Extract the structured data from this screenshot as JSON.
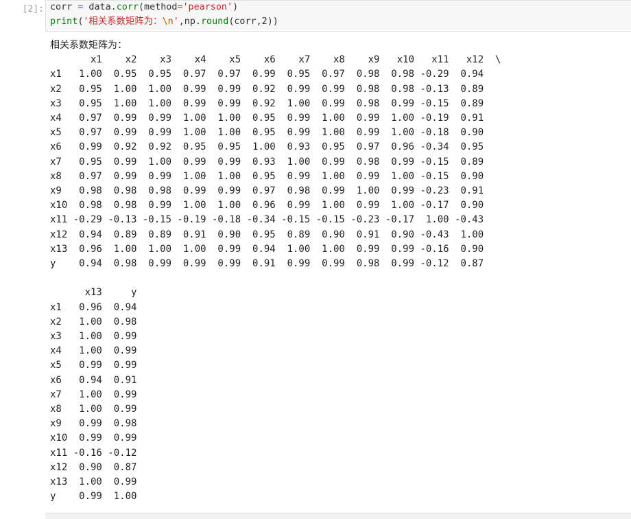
{
  "cell": {
    "prompt": "[2]:",
    "code": {
      "line1": {
        "a": "corr",
        "b": " ",
        "c": "=",
        "d": " data.",
        "e": "corr",
        "f": "(method",
        "g": "=",
        "h": "'pearson'",
        "i": ")"
      },
      "line2": {
        "a": "print",
        "b": "(",
        "c": "'相关系数矩阵为：",
        "d": "\\n",
        "e": "'",
        "f": ",np.",
        "g": "round",
        "h": "(corr,2))"
      }
    }
  },
  "output": {
    "text": "相关系数矩阵为：\n       x1    x2    x3    x4    x5    x6    x7    x8    x9   x10   x11   x12  \\\nx1   1.00  0.95  0.95  0.97  0.97  0.99  0.95  0.97  0.98  0.98 -0.29  0.94\nx2   0.95  1.00  1.00  0.99  0.99  0.92  0.99  0.99  0.98  0.98 -0.13  0.89\nx3   0.95  1.00  1.00  0.99  0.99  0.92  1.00  0.99  0.98  0.99 -0.15  0.89\nx4   0.97  0.99  0.99  1.00  1.00  0.95  0.99  1.00  0.99  1.00 -0.19  0.91\nx5   0.97  0.99  0.99  1.00  1.00  0.95  0.99  1.00  0.99  1.00 -0.18  0.90\nx6   0.99  0.92  0.92  0.95  0.95  1.00  0.93  0.95  0.97  0.96 -0.34  0.95\nx7   0.95  0.99  1.00  0.99  0.99  0.93  1.00  0.99  0.98  0.99 -0.15  0.89\nx8   0.97  0.99  0.99  1.00  1.00  0.95  0.99  1.00  0.99  1.00 -0.15  0.90\nx9   0.98  0.98  0.98  0.99  0.99  0.97  0.98  0.99  1.00  0.99 -0.23  0.91\nx10  0.98  0.98  0.99  1.00  1.00  0.96  0.99  1.00  0.99  1.00 -0.17  0.90\nx11 -0.29 -0.13 -0.15 -0.19 -0.18 -0.34 -0.15 -0.15 -0.23 -0.17  1.00 -0.43\nx12  0.94  0.89  0.89  0.91  0.90  0.95  0.89  0.90  0.91  0.90 -0.43  1.00\nx13  0.96  1.00  1.00  1.00  0.99  0.94  1.00  1.00  0.99  0.99 -0.16  0.90\ny    0.94  0.98  0.99  0.99  0.99  0.91  0.99  0.99  0.98  0.99 -0.12  0.87\n\n      x13     y\nx1   0.96  0.94\nx2   1.00  0.98\nx3   1.00  0.99\nx4   1.00  0.99\nx5   0.99  0.99\nx6   0.94  0.91\nx7   1.00  0.99\nx8   1.00  0.99\nx9   0.99  0.98\nx10  0.99  0.99\nx11 -0.16 -0.12\nx12  0.90  0.87\nx13  1.00  0.99\ny    0.99  1.00"
  },
  "colors": {
    "keyword": "#0b7d0b",
    "operator": "#9b2bd9",
    "string": "#c22727",
    "escape": "#b35900",
    "prompt": "#9e9e9e"
  }
}
